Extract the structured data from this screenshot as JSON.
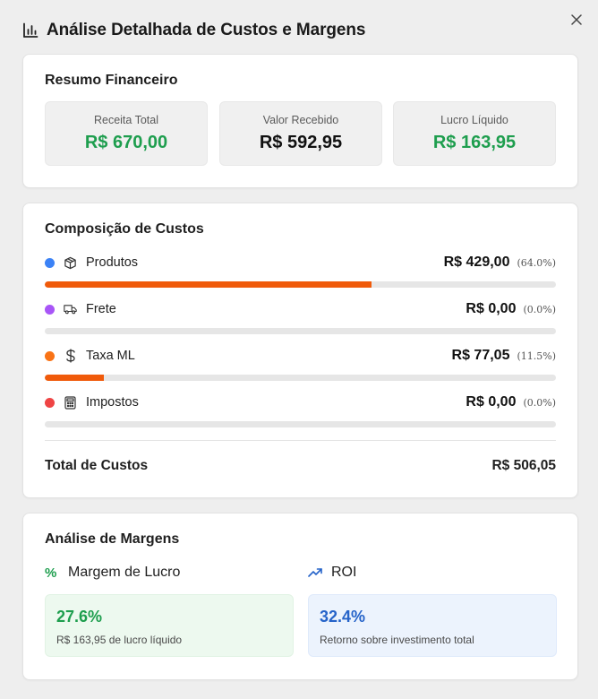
{
  "header": {
    "title": "Análise Detalhada de Custos e Margens",
    "icon": "bar-chart-icon"
  },
  "colors": {
    "green": "#1e9e4e",
    "blue": "#2563c9",
    "orange": "#f05a0a",
    "dot_blue": "#3b82f6",
    "dot_purple": "#a855f7",
    "dot_orange": "#f97316",
    "dot_red": "#ef4444"
  },
  "resumo": {
    "title": "Resumo Financeiro",
    "stats": [
      {
        "label": "Receita Total",
        "value": "R$ 670,00"
      },
      {
        "label": "Valor Recebido",
        "value": "R$ 592,95"
      },
      {
        "label": "Lucro Líquido",
        "value": "R$ 163,95"
      }
    ]
  },
  "composicao": {
    "title": "Composição de Custos",
    "items": [
      {
        "name": "Produtos",
        "amount": "R$ 429,00",
        "pct": "(64.0%)",
        "fraction": 0.64,
        "icon": "package-icon"
      },
      {
        "name": "Frete",
        "amount": "R$ 0,00",
        "pct": "(0.0%)",
        "fraction": 0.0,
        "icon": "truck-icon"
      },
      {
        "name": "Taxa ML",
        "amount": "R$ 77,05",
        "pct": "(11.5%)",
        "fraction": 0.115,
        "icon": "dollar-icon"
      },
      {
        "name": "Impostos",
        "amount": "R$ 0,00",
        "pct": "(0.0%)",
        "fraction": 0.0,
        "icon": "calculator-icon"
      }
    ],
    "total_label": "Total de Custos",
    "total_value": "R$ 506,05"
  },
  "margens": {
    "title": "Análise de Margens",
    "lucro": {
      "label": "Margem de Lucro",
      "value": "27.6%",
      "subtitle": "R$ 163,95 de lucro líquido",
      "icon": "percent-icon"
    },
    "roi": {
      "label": "ROI",
      "value": "32.4%",
      "subtitle": "Retorno sobre investimento total",
      "icon": "trending-up-icon"
    }
  }
}
